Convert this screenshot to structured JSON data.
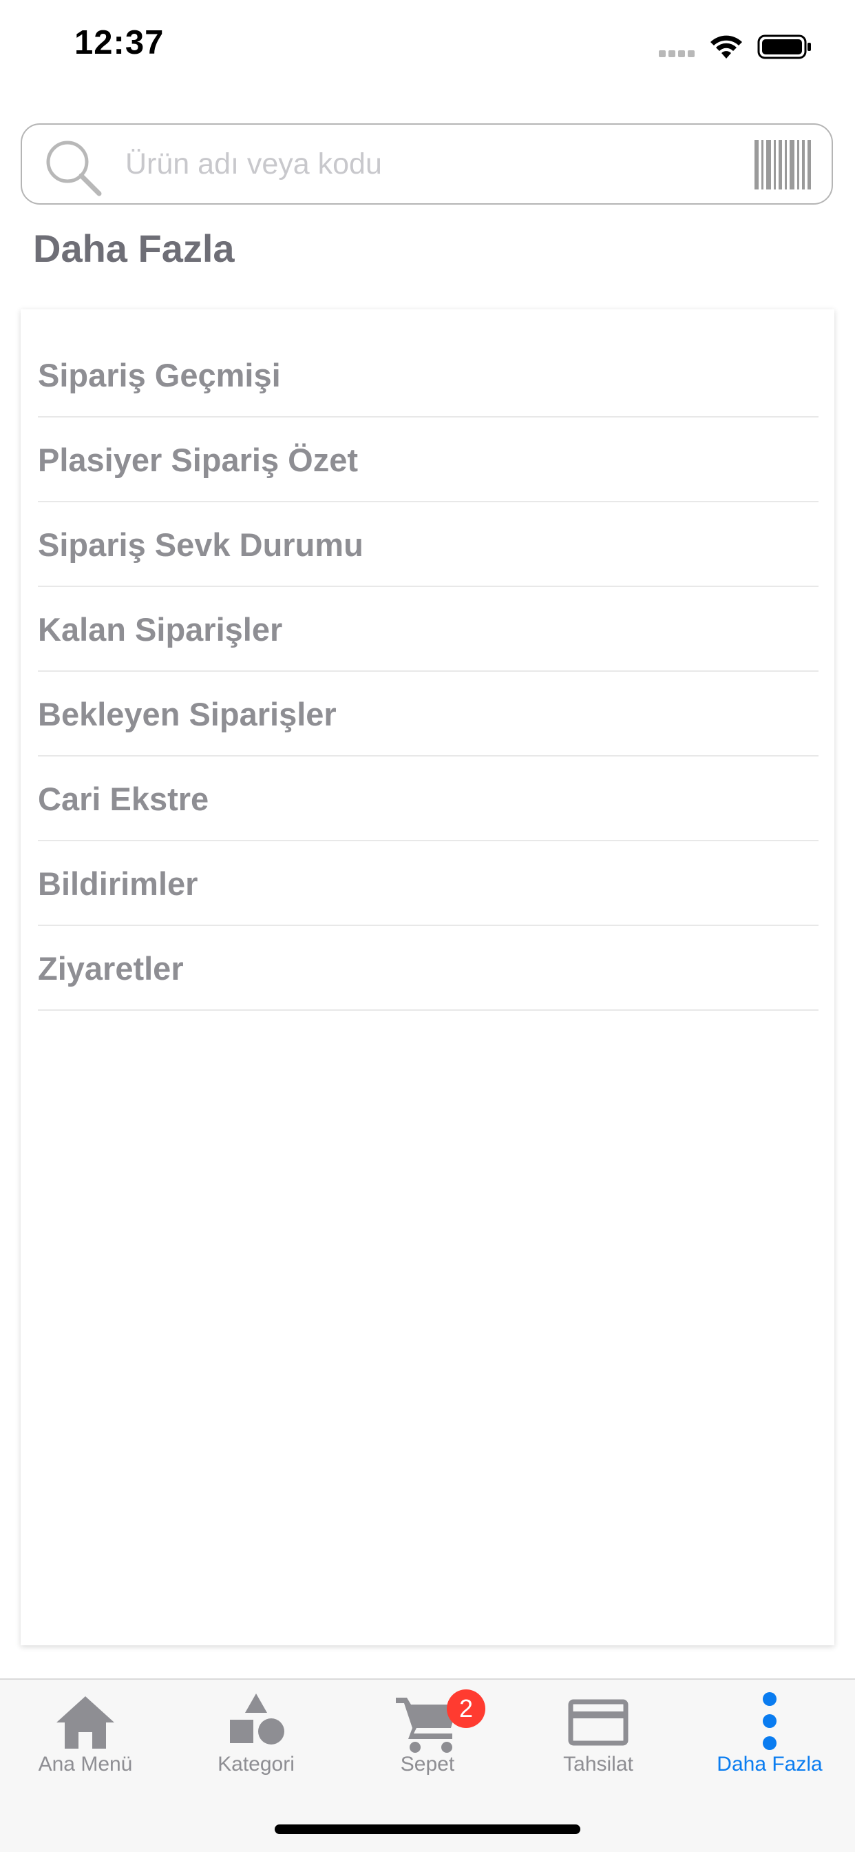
{
  "status_bar": {
    "time": "12:37"
  },
  "search": {
    "placeholder": "Ürün adı veya kodu",
    "value": ""
  },
  "section_title": "Daha Fazla",
  "menu": {
    "items": [
      {
        "label": "Sipariş Geçmişi"
      },
      {
        "label": "Plasiyer Sipariş Özet"
      },
      {
        "label": "Sipariş Sevk Durumu"
      },
      {
        "label": "Kalan Siparişler"
      },
      {
        "label": "Bekleyen Siparişler"
      },
      {
        "label": "Cari Ekstre"
      },
      {
        "label": "Bildirimler"
      },
      {
        "label": "Ziyaretler"
      }
    ]
  },
  "tab_bar": {
    "tabs": [
      {
        "label": "Ana Menü",
        "icon": "home-icon"
      },
      {
        "label": "Kategori",
        "icon": "shapes-icon"
      },
      {
        "label": "Sepet",
        "icon": "cart-icon",
        "badge": "2"
      },
      {
        "label": "Tahsilat",
        "icon": "credit-card-icon"
      },
      {
        "label": "Daha Fazla",
        "icon": "more-vertical-icon",
        "active": true
      }
    ]
  },
  "colors": {
    "accent": "#0a7cf0",
    "badge": "#ff3b30",
    "text_muted": "#8e8e93",
    "title": "#6e6e76"
  }
}
